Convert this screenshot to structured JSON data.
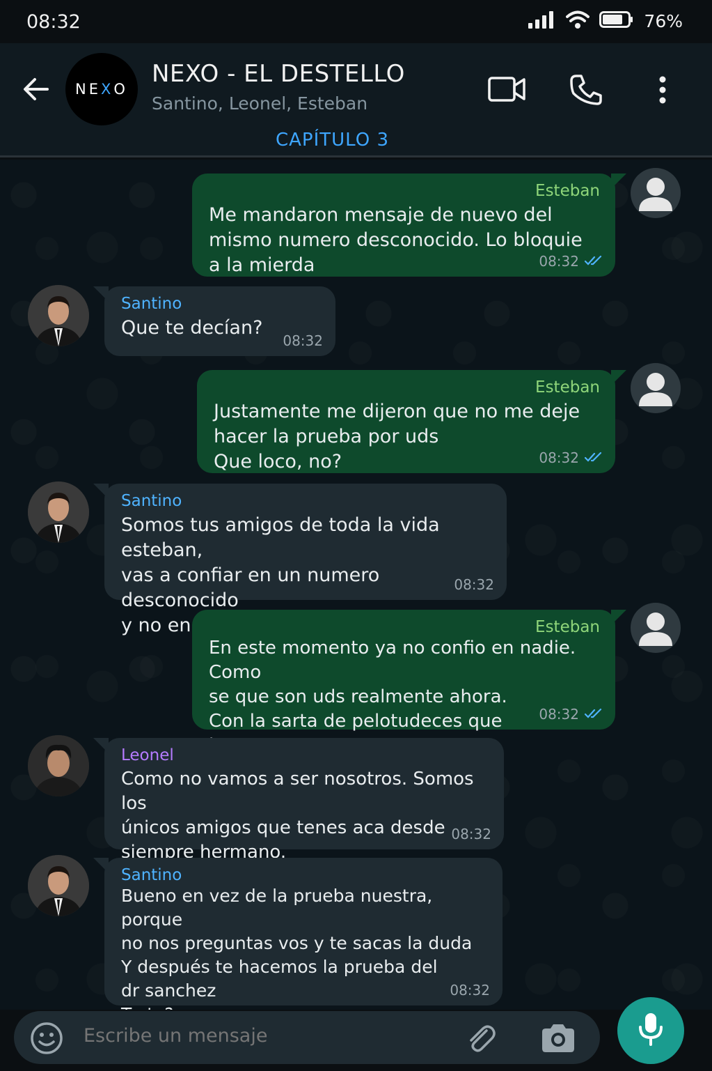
{
  "status_bar": {
    "time": "08:32",
    "battery": "76%"
  },
  "header": {
    "avatar_text_a": "NE",
    "avatar_text_x": "X",
    "avatar_text_b": "O",
    "title": "NEXO - EL DESTELLO",
    "members": "Santino, Leonel, Esteban",
    "chapter": "CAPÍTULO 3"
  },
  "messages": [
    {
      "sender": "Esteban",
      "text": "Me mandaron mensaje de nuevo del\nmismo numero desconocido. Lo bloquie\na la mierda",
      "time": "08:32",
      "direction": "out"
    },
    {
      "sender": "Santino",
      "text": "Que te decían?",
      "time": "08:32",
      "direction": "in",
      "sender_color": "#4fb3ff"
    },
    {
      "sender": "Esteban",
      "text": "Justamente me dijeron que no me deje\nhacer la prueba por uds\nQue loco, no?",
      "time": "08:32",
      "direction": "out"
    },
    {
      "sender": "Santino",
      "text": "Somos tus amigos de toda la vida esteban,\nvas a confiar en un numero desconocido\ny no en nosotros?",
      "time": "08:32",
      "direction": "in",
      "sender_color": "#4fb3ff"
    },
    {
      "sender": "Esteban",
      "text": "En este momento ya no confio en nadie. Como\nse que son uds realmente ahora.\nCon la sarta de pelotudeces que inventaron,\nya no se que creer",
      "time": "08:32",
      "direction": "out"
    },
    {
      "sender": "Leonel",
      "text": "Como no vamos a ser nosotros. Somos los\núnicos amigos que tenes aca desde\nsiempre hermano.",
      "time": "08:32",
      "direction": "in",
      "sender_color": "#b57bff"
    },
    {
      "sender": "Santino",
      "text": "Bueno en vez de la prueba nuestra, porque\nno nos preguntas vos y te sacas la duda\nY después te hacemos la prueba del\ndr sanchez\nTrato?",
      "time": "08:32",
      "direction": "in",
      "sender_color": "#4fb3ff"
    }
  ],
  "input": {
    "placeholder": "Escribe un mensaje"
  },
  "colors": {
    "outgoing_bubble": "#0e4a2c",
    "incoming_bubble": "#1f2b32",
    "accent": "#3ea6ff",
    "mic_button": "#1a9c8f"
  }
}
